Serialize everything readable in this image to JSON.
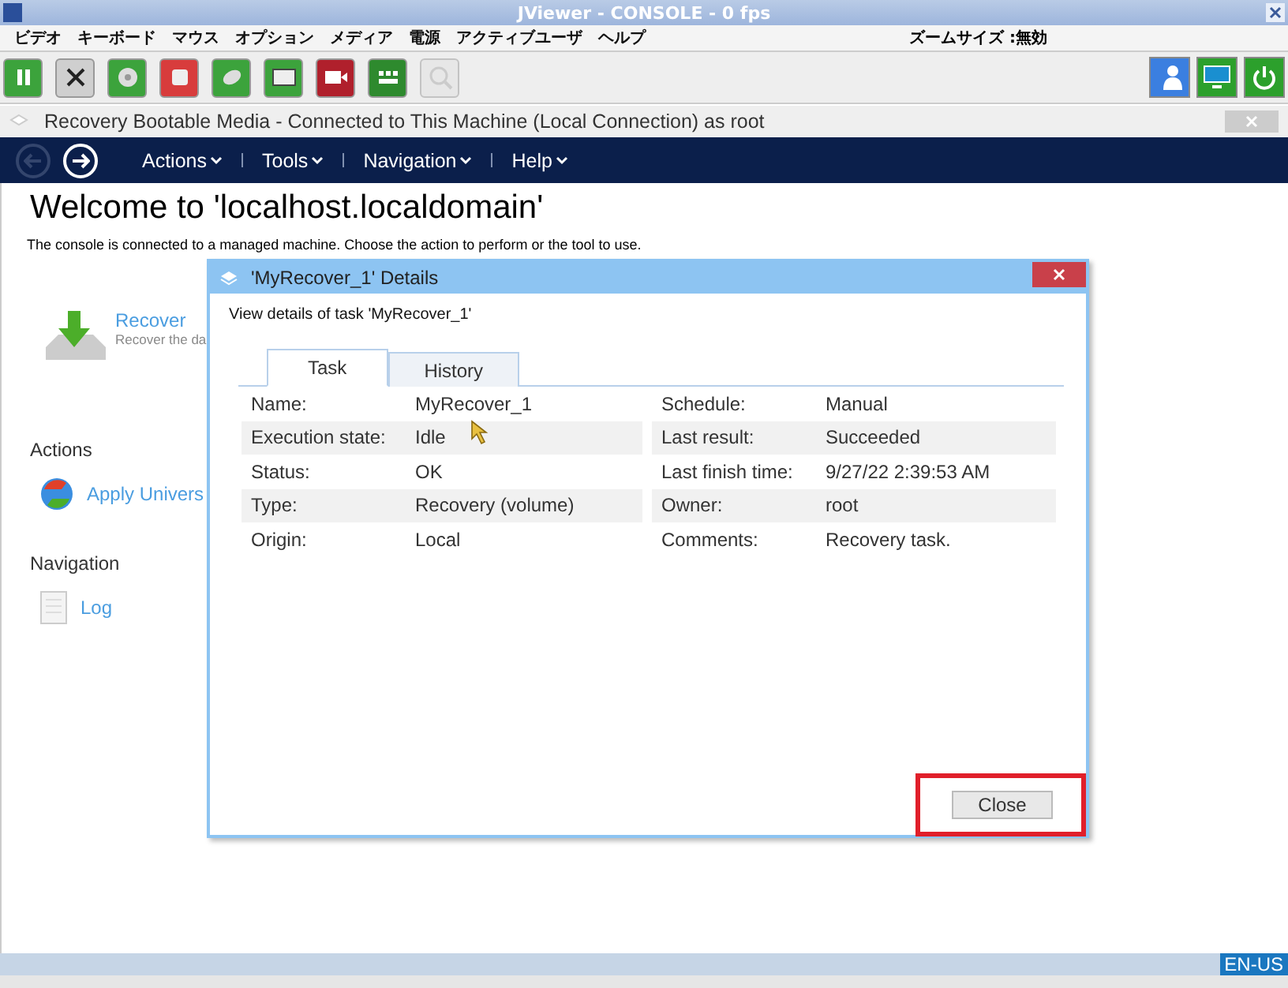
{
  "window": {
    "title": "JViewer - CONSOLE - 0 fps"
  },
  "menu": [
    "ビデオ",
    "キーボード",
    "マウス",
    "オプション",
    "メディア",
    "電源",
    "アクティブユーザ",
    "ヘルプ"
  ],
  "zoom_status": "ズームサイズ :無効",
  "toolbar": [
    {
      "kind": "pause",
      "disabled": false
    },
    {
      "kind": "fullscreen",
      "disabled": false
    },
    {
      "kind": "cd",
      "disabled": false
    },
    {
      "kind": "drive",
      "disabled": false
    },
    {
      "kind": "mouse",
      "disabled": false
    },
    {
      "kind": "keyboard",
      "disabled": false
    },
    {
      "kind": "record",
      "disabled": false
    },
    {
      "kind": "grid",
      "disabled": false
    },
    {
      "kind": "zoom",
      "disabled": true
    }
  ],
  "toolbar_right": [
    {
      "kind": "user"
    },
    {
      "kind": "monitor"
    },
    {
      "kind": "power"
    }
  ],
  "app": {
    "title": "Recovery Bootable Media - Connected to This Machine (Local Connection) as root",
    "nav": [
      "Actions",
      "Tools",
      "Navigation",
      "Help"
    ],
    "heading": "Welcome to 'localhost.localdomain'",
    "intro": "The console is connected to a managed machine. Choose the action to perform or the tool to use.",
    "recover": {
      "label": "Recover",
      "description": "Recover the da"
    },
    "actions_heading": "Actions",
    "action": "Apply Univers",
    "navigation_heading": "Navigation",
    "navigation_item": "Log"
  },
  "dialog": {
    "title": "'MyRecover_1' Details",
    "subtitle": "View details of task 'MyRecover_1'",
    "tabs": [
      {
        "label": "Task",
        "selected": true
      },
      {
        "label": "History",
        "selected": false
      }
    ],
    "rows": [
      {
        "label": "Name:",
        "value": "MyRecover_1",
        "label_2": "Schedule:",
        "value_2": "Manual"
      },
      {
        "label": "Execution state:",
        "value": "Idle",
        "label_2": "Last result:",
        "value_2": "Succeeded"
      },
      {
        "label": "Status:",
        "value": "OK",
        "label_2": "Last finish time:",
        "value_2": "9/27/22 2:39:53 AM"
      },
      {
        "label": "Type:",
        "value": "Recovery (volume)",
        "label_2": "Owner:",
        "value_2": "root"
      },
      {
        "label": "Origin:",
        "value": "Local",
        "label_2": "Comments:",
        "value_2": "Recovery task."
      }
    ],
    "close_button": "Close"
  },
  "language": "EN-US"
}
